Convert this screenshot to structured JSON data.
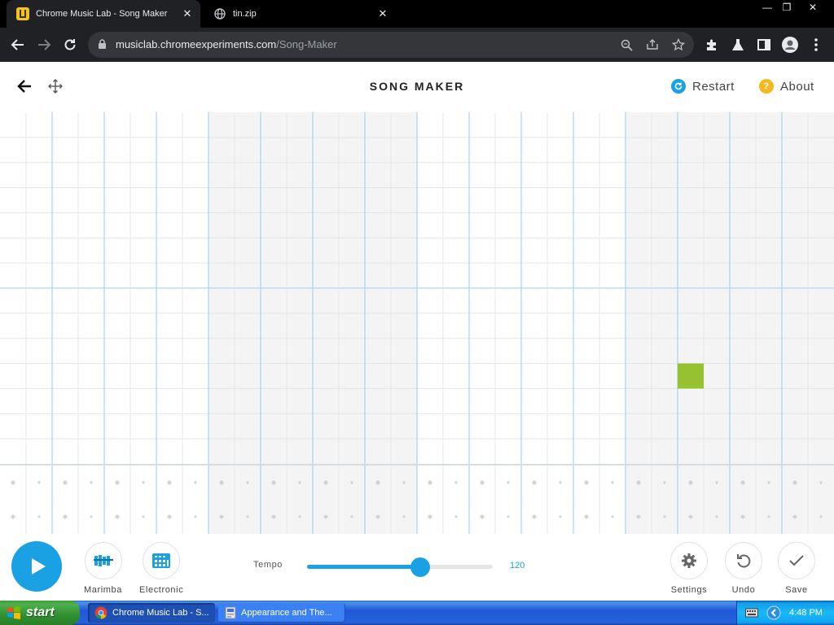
{
  "browser": {
    "tabs": [
      {
        "title": "Chrome Music Lab - Song Maker",
        "active": true
      },
      {
        "title": "tin.zip",
        "active": false
      }
    ],
    "url_host": "musiclab.chromeexperiments.com",
    "url_path": "/Song-Maker"
  },
  "app": {
    "title": "SONG MAKER",
    "restart_label": "Restart",
    "about_label": "About",
    "about_glyph": "?",
    "accent_color": "#1aa1e4",
    "note_color": "#96c22f"
  },
  "grid": {
    "columns": 32,
    "melody_rows": 14,
    "percussion_rows": 2,
    "active_notes": [
      {
        "column": 26,
        "row": 10
      }
    ]
  },
  "controls": {
    "instrument_label": "Marimba",
    "percussion_label": "Electronic",
    "tempo_label": "Tempo",
    "tempo_value": "120",
    "tempo_fraction": 0.61,
    "settings_label": "Settings",
    "undo_label": "Undo",
    "save_label": "Save"
  },
  "taskbar": {
    "start_label": "start",
    "tasks": [
      {
        "title": "Chrome Music Lab - S...",
        "active": true
      },
      {
        "title": "Appearance and The...",
        "active": false
      }
    ],
    "clock": "4:48 PM"
  }
}
